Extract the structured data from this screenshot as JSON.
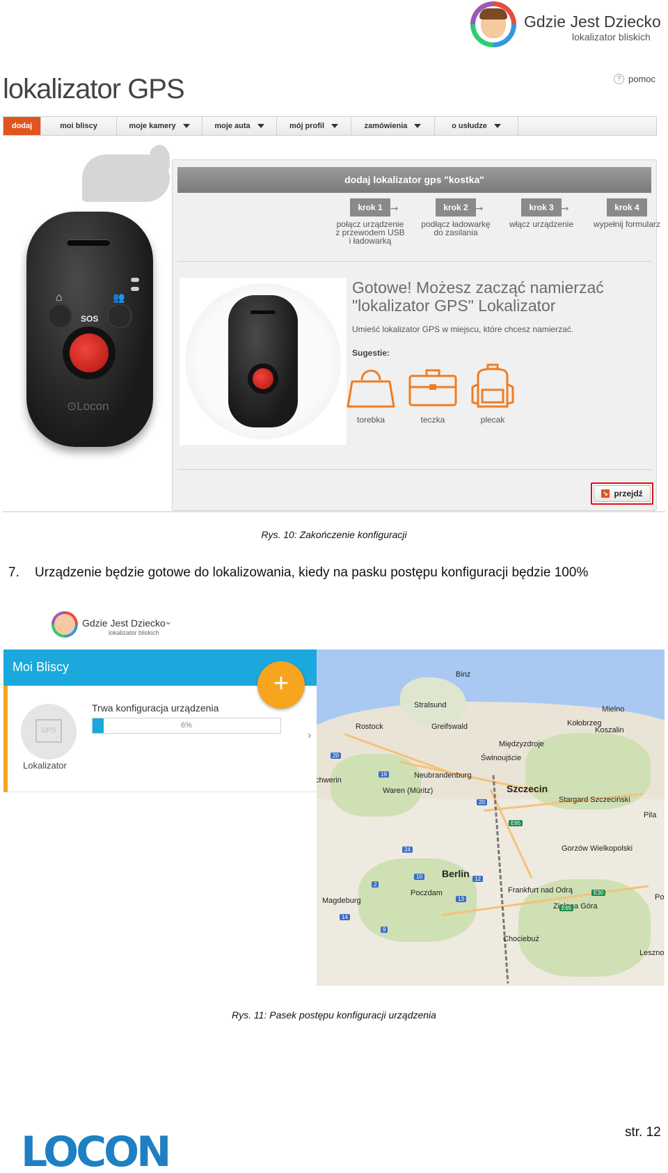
{
  "brand": {
    "name": "Gdzie Jest Dziecko",
    "tagline": "lokalizator bliskich"
  },
  "figure1": {
    "app_title": "lokalizator GPS",
    "help_label": "pomoc",
    "nav": [
      {
        "label": "dodaj",
        "active": true,
        "dropdown": false
      },
      {
        "label": "moi bliscy",
        "active": false,
        "dropdown": false
      },
      {
        "label": "moje kamery",
        "active": false,
        "dropdown": true
      },
      {
        "label": "moje auta",
        "active": false,
        "dropdown": true
      },
      {
        "label": "mój profil",
        "active": false,
        "dropdown": true
      },
      {
        "label": "zamówienia",
        "active": false,
        "dropdown": true
      },
      {
        "label": "o usłudze",
        "active": false,
        "dropdown": true
      }
    ],
    "device": {
      "sos_label": "SOS",
      "brand": "⊙Locon"
    },
    "panel_title": "dodaj lokalizator gps \"kostka\"",
    "steps": [
      {
        "label": "krok 1",
        "desc": "połącz urządzenie z przewodem USB i ładowarką"
      },
      {
        "label": "krok 2",
        "desc": "podłącz ładowarkę do zasilania"
      },
      {
        "label": "krok 3",
        "desc": "włącz urządzenie"
      },
      {
        "label": "krok 4",
        "desc": "wypełnij formularz"
      }
    ],
    "ready_heading": "Gotowe! Możesz zacząć namierzać \"lokalizator GPS\" Lokalizator",
    "hint": "Umieść lokalizator GPS w miejscu, które chcesz namierzać.",
    "suggestions_label": "Sugestie:",
    "suggestions": [
      {
        "label": "torebka",
        "icon": "handbag-icon"
      },
      {
        "label": "teczka",
        "icon": "briefcase-icon"
      },
      {
        "label": "plecak",
        "icon": "backpack-icon"
      }
    ],
    "go_button": "przejdź",
    "caption": "Rys. 10: Zakończenie konfiguracji"
  },
  "paragraph": {
    "number": "7.",
    "text": "Urządzenie będzie gotowe do lokalizowania, kiedy na pasku postępu konfiguracji będzie 100%"
  },
  "figure2": {
    "panel_title": "Moi Bliscy",
    "add_button": "+",
    "device_label": "Lokalizator",
    "avatar_text": "GPS",
    "config_title": "Trwa konfiguracja urządzenia",
    "progress": {
      "value": 0.06,
      "label": "6%"
    },
    "map_labels": [
      "Binz",
      "Stralsund",
      "Rostock",
      "Greifswald",
      "Międzyzdroje",
      "Świnoujście",
      "Mielno",
      "Kołobrzeg",
      "Koszalin",
      "chwerin",
      "Neubrandenburg",
      "Waren (Müritz)",
      "Szczecin",
      "Stargard Szczeciński",
      "Pila",
      "Gorzów Wielkopolski",
      "Berlin",
      "Frankfurt nad Odrą",
      "Poczdam",
      "Magdeburg",
      "Zielona Góra",
      "Chociebuż",
      "Leszno",
      "Po"
    ],
    "road_shields": [
      "20",
      "19",
      "20",
      "E65",
      "24",
      "10",
      "12",
      "2",
      "13",
      "14",
      "9",
      "E30",
      "E65"
    ],
    "caption": "Rys. 11: Pasek postępu konfiguracji urządzenia"
  },
  "footer": {
    "logo": "LOCON",
    "page": "str. 12"
  },
  "colors": {
    "accent_orange": "#e2541f",
    "progress_blue": "#1aa8dd",
    "fab_orange": "#f7a51f",
    "logo_blue": "#1e7fc2"
  }
}
